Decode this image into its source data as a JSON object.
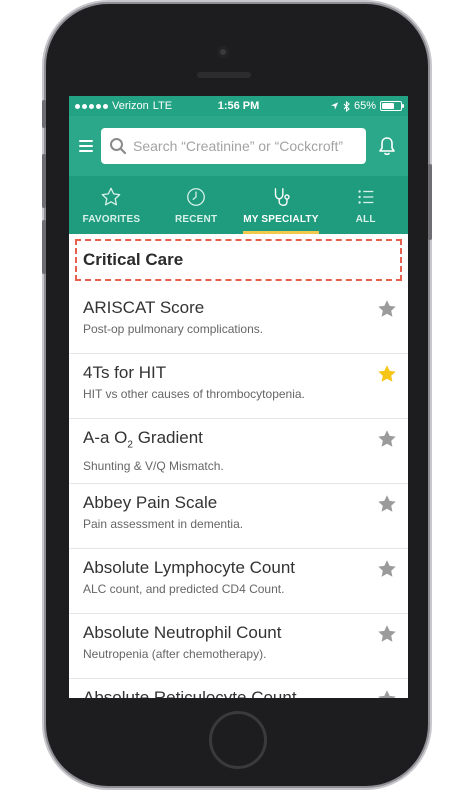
{
  "status_bar": {
    "carrier": "Verizon",
    "network": "LTE",
    "time": "1:56 PM",
    "battery": "65%",
    "battery_level": 0.65
  },
  "search": {
    "placeholder": "Search “Creatinine” or “Cockcroft”"
  },
  "tabs": [
    {
      "label": "FAVORITES",
      "icon": "star-outline-icon"
    },
    {
      "label": "RECENT",
      "icon": "clock-icon"
    },
    {
      "label": "MY SPECIALTY",
      "icon": "stethoscope-icon",
      "active": true
    },
    {
      "label": "ALL",
      "icon": "list-icon"
    }
  ],
  "section": {
    "title": "Critical Care"
  },
  "items": [
    {
      "title": "ARISCAT Score",
      "subtitle": "Post-op pulmonary complications.",
      "favorite": false
    },
    {
      "title": "4Ts for HIT",
      "subtitle": "HIT vs other causes of thrombocytopenia.",
      "favorite": true
    },
    {
      "title_main": "A-a O",
      "title_sub": "2",
      "title_end": " Gradient",
      "subtitle": "Shunting & V/Q Mismatch.",
      "favorite": false
    },
    {
      "title": "Abbey Pain Scale",
      "subtitle": "Pain assessment in dementia.",
      "favorite": false
    },
    {
      "title": "Absolute Lymphocyte Count",
      "subtitle": "ALC count, and predicted CD4 Count.",
      "favorite": false
    },
    {
      "title": "Absolute Neutrophil Count",
      "subtitle": "Neutropenia (after chemotherapy).",
      "favorite": false
    },
    {
      "title": "Absolute Reticulocyte Count",
      "subtitle": "",
      "favorite": false
    }
  ],
  "colors": {
    "header_green": "#2aa889",
    "tab_green": "#1f9c7e",
    "active_tab_underline": "#f2c94c",
    "favorite_star": "#f5c518",
    "inactive_star": "#9b9b9b",
    "highlight_border": "#e8604c"
  }
}
